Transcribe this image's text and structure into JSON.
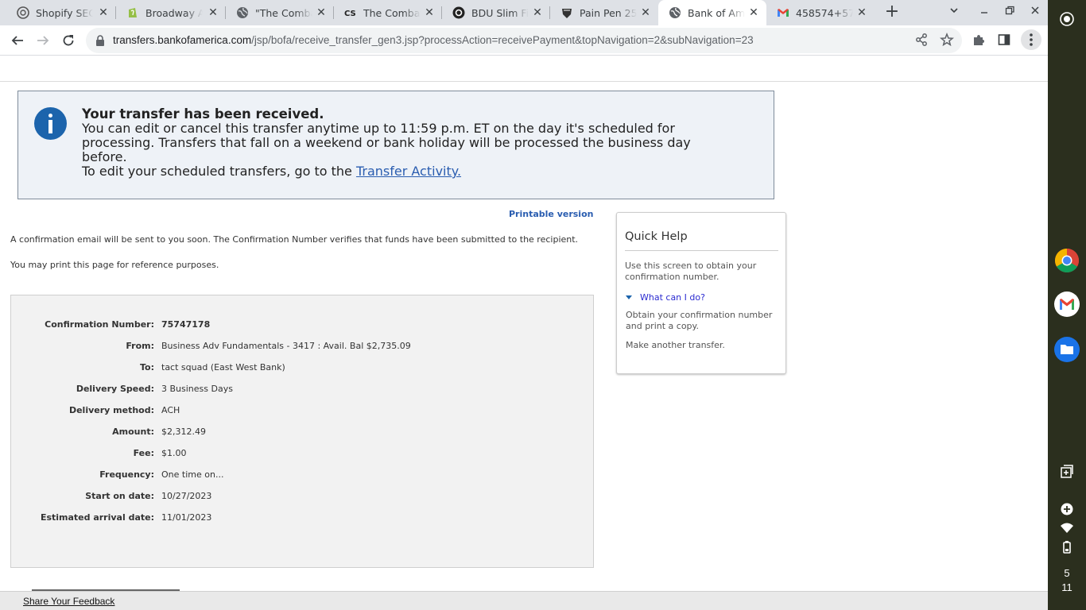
{
  "browser": {
    "tabs": [
      {
        "title": "Shopify SEO S",
        "icon": "chatgpt-icon"
      },
      {
        "title": "Broadway Am",
        "icon": "shopify-icon"
      },
      {
        "title": "\"The Combat",
        "icon": "globe-icon"
      },
      {
        "title": "The Combat",
        "icon": "cs-logo-icon"
      },
      {
        "title": "BDU Slim Fit",
        "icon": "circle-logo-icon"
      },
      {
        "title": "Pain Pen 25,",
        "icon": "shield-logo-icon"
      },
      {
        "title": "Bank of Amer",
        "icon": "globe-icon",
        "active": true
      },
      {
        "title": "458574+576",
        "icon": "gmail-icon"
      }
    ],
    "url_host": "transfers.bankofamerica.com",
    "url_path": "/jsp/bofa/receive_transfer_gen3.jsp?processAction=receivePayment&topNavigation=2&subNavigation=23"
  },
  "notice": {
    "heading": "Your transfer has been received.",
    "line1": "You can edit or cancel this transfer anytime up to 11:59 p.m. ET on the day it's scheduled for",
    "line2": "processing. Transfers that fall on a weekend or bank holiday will be processed the business day",
    "line3": "before.",
    "line4_prefix": "To edit your scheduled transfers, go to the ",
    "link": "Transfer Activity."
  },
  "printable_version": "Printable version",
  "paragraphs": {
    "confirmation_email": "A confirmation email will be sent to you soon. The Confirmation Number verifies that funds have been submitted to the recipient.",
    "print_note": "You may print this page for reference purposes."
  },
  "details": [
    {
      "label": "Confirmation Number:",
      "value": "75747178",
      "bold": true
    },
    {
      "label": "From:",
      "value": "Business Adv Fundamentals - 3417 : Avail. Bal $2,735.09"
    },
    {
      "label": "To:",
      "value": "tact squad (East West Bank)"
    },
    {
      "label": "Delivery Speed:",
      "value": "3 Business Days"
    },
    {
      "label": "Delivery method:",
      "value": "ACH"
    },
    {
      "label": "Amount:",
      "value": "$2,312.49"
    },
    {
      "label": "Fee:",
      "value": "$1.00"
    },
    {
      "label": "Frequency:",
      "value": "One time on..."
    },
    {
      "label": "Start on date:",
      "value": "10/27/2023"
    },
    {
      "label": "Estimated arrival date:",
      "value": "11/01/2023"
    }
  ],
  "quick_help": {
    "title": "Quick Help",
    "intro": "Use this screen to obtain your confirmation number.",
    "link": "What can I do?",
    "answer": "Obtain your confirmation number and print a copy.",
    "another": "Make another transfer."
  },
  "feedback": "Share Your Feedback",
  "shelf": {
    "clock_hour": "5",
    "clock_minute": "11"
  },
  "colors": {
    "link_blue": "#2a5db0",
    "info_blue": "#1c64ac",
    "notice_bg": "#eef2f7"
  }
}
